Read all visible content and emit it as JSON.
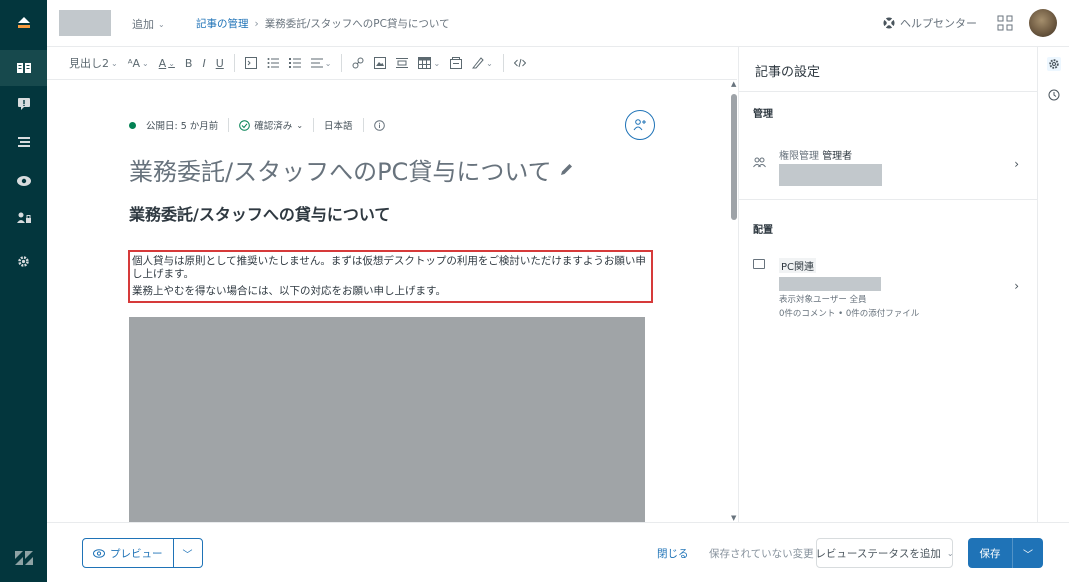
{
  "header": {
    "add_label": "追加",
    "breadcrumb": {
      "parent": "記事の管理",
      "separator": "›",
      "current": "業務委託/スタッフへのPC貸与について"
    },
    "help_label": "ヘルプセンター"
  },
  "toolbar": {
    "heading_select": "見出し2",
    "font_size": "ᴬA",
    "text_color": "A",
    "bold": "B",
    "italic": "I",
    "underline": "U"
  },
  "editor": {
    "status": "公開日: 5 か月前",
    "verified": "確認済み",
    "language": "日本語",
    "title": "業務委託/スタッフへのPC貸与について",
    "heading": "業務委託/スタッフへの貸与について",
    "paragraphs": [
      "個人貸与は原則として推奨いたしません。まずは仮想デスクトップの利用をご検討いただけますようお願い申し上げます。",
      "業務上やむを得ない場合には、以下の対応をお願い申し上げます。"
    ]
  },
  "settings": {
    "title": "記事の設定",
    "management_title": "管理",
    "permission_label": "権限管理",
    "permission_value": "管理者",
    "placement_title": "配置",
    "section_name": "PC関連",
    "visible_to": "表示対象ユーザー 全員",
    "counts": "0件のコメント • 0件の添付ファイル"
  },
  "footer": {
    "preview_label": "プレビュー",
    "close_label": "閉じる",
    "unsaved_label": "保存されていない変更",
    "review_label": "レビューステータスを追加",
    "save_label": "保存"
  },
  "colors": {
    "nav_bg": "#03363d",
    "accent": "#1f73b7",
    "highlight_border": "#d63a3a",
    "published_dot": "#038153"
  }
}
